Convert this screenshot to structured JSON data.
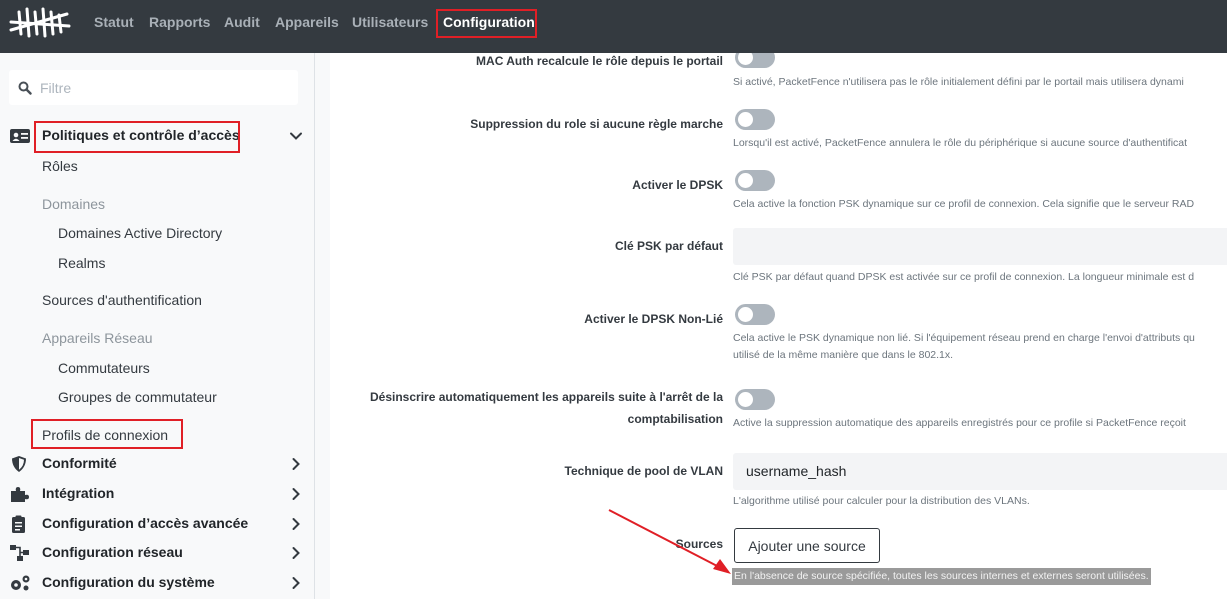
{
  "header": {
    "nav": [
      "Statut",
      "Rapports",
      "Audit",
      "Appareils",
      "Utilisateurs",
      "Configuration"
    ],
    "active": "Configuration"
  },
  "sidebar": {
    "search_placeholder": "Filtre",
    "section_active": "Politiques et contrôle d’accès",
    "items": {
      "roles": "Rôles",
      "domains_group": "Domaines",
      "ad_domains": "Domaines Active Directory",
      "realms": "Realms",
      "auth_sources": "Sources d'authentification",
      "net_devices_group": "Appareils Réseau",
      "switches": "Commutateurs",
      "switch_groups": "Groupes de commutateur",
      "conn_profiles": "Profils de connexion"
    },
    "sections": [
      "Conformité",
      "Intégration",
      "Configuration d’accès avancée",
      "Configuration réseau",
      "Configuration du système"
    ]
  },
  "form": {
    "mac_auth_label": "MAC Auth recalcule le rôle depuis le portail",
    "mac_auth_help": "Si activé, PacketFence n'utilisera pas le rôle initialement défini par le portail mais utilisera dynami",
    "remove_role_label": "Suppression du role si aucune règle marche",
    "remove_role_help": "Lorsqu'il est activé, PacketFence annulera le rôle du périphérique si aucune source d'authentificat",
    "dpsk_label": "Activer le DPSK",
    "dpsk_help": "Cela active la fonction PSK dynamique sur ce profil de connexion. Cela signifie que le serveur RAD",
    "psk_label": "Clé PSK par défaut",
    "psk_value": "",
    "psk_help": "Clé PSK par défaut quand DPSK est activée sur ce profil de connexion. La longueur minimale est d",
    "dpsk_unbound_label": "Activer le DPSK Non-Lié",
    "dpsk_unbound_help_1": "Cela active le PSK dynamique non lié. Si l'équipement réseau prend en charge l'envoi d'attributs qu",
    "dpsk_unbound_help_2": "utilisé de la même manière que dans le 802.1x.",
    "unreg_label_1": "Désinscrire automatiquement les appareils suite à l'arrêt de la",
    "unreg_label_2": "comptabilisation",
    "unreg_help": "Active la suppression automatique des appareils enregistrés pour ce profile si PacketFence reçoit",
    "vlan_label": "Technique de pool de VLAN",
    "vlan_value": "username_hash",
    "vlan_help": "L'algorithme utilisé pour calculer pour la distribution des VLANs.",
    "sources_label": "Sources",
    "add_source_button": "Ajouter une source",
    "sources_help": "En l'absence de source spécifiée, toutes les sources internes et externes seront utilisées."
  },
  "colors": {
    "highlight": "#e01f26",
    "navbar": "#343a40"
  }
}
